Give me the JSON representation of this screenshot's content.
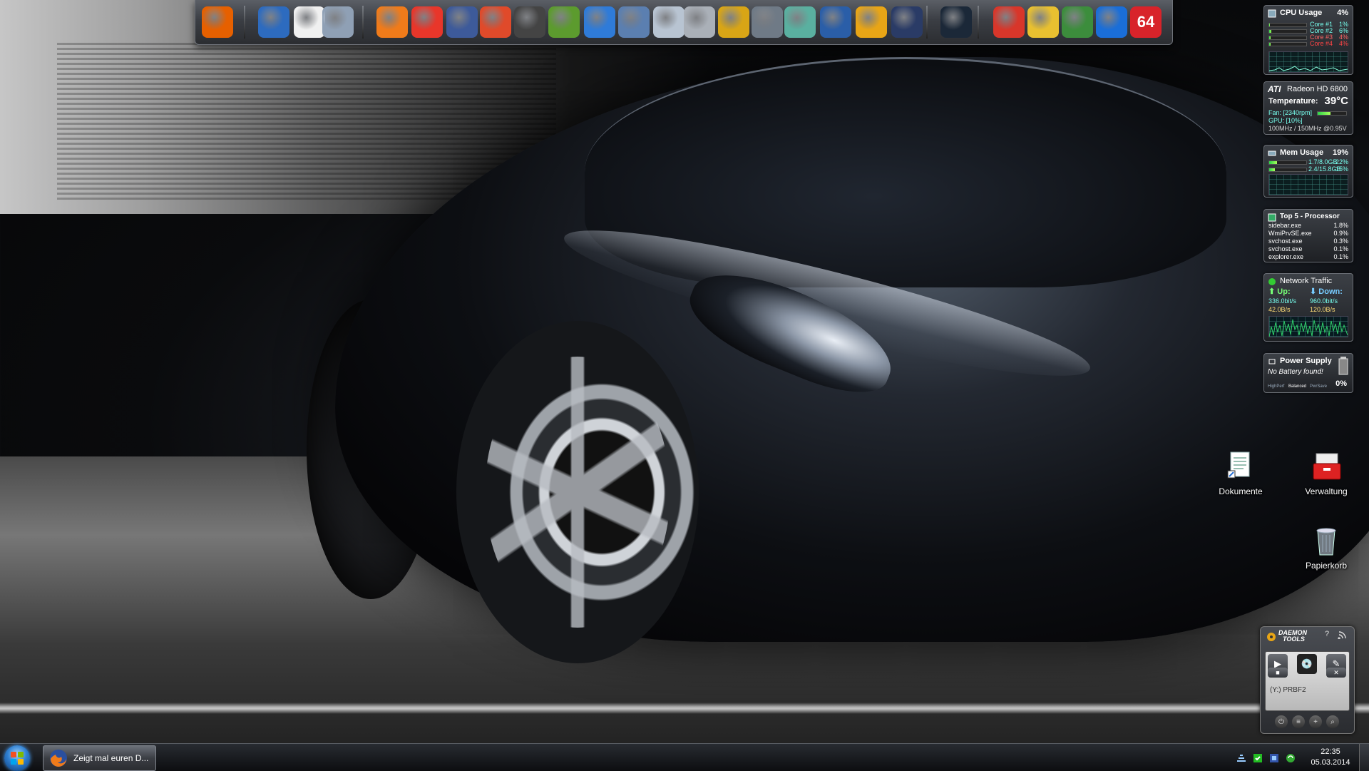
{
  "dock": {
    "icons": [
      {
        "name": "firefox-icon",
        "color": "#e66000"
      },
      {
        "name": "thunderbird-icon",
        "color": "#2d6bbf"
      },
      {
        "name": "notepad-icon",
        "color": "#f0f0f0"
      },
      {
        "name": "network-tool-icon",
        "color": "#8fa0b5"
      },
      {
        "name": "chat-icon",
        "color": "#f07b1a"
      },
      {
        "name": "flash-icon",
        "color": "#e8362a"
      },
      {
        "name": "lock-icon",
        "color": "#3d5a9a"
      },
      {
        "name": "tasks-icon",
        "color": "#e04a2a"
      },
      {
        "name": "countdown-icon",
        "color": "#444"
      },
      {
        "name": "image-editor-icon",
        "color": "#5c9b2e"
      },
      {
        "name": "cloud-icon",
        "color": "#2f7bd8"
      },
      {
        "name": "remote-desktop-icon",
        "color": "#5b7fb0"
      },
      {
        "name": "calculator-icon",
        "color": "#b8c4d2"
      },
      {
        "name": "scanner-icon",
        "color": "#aab0b8"
      },
      {
        "name": "sync-icon",
        "color": "#d8a516"
      },
      {
        "name": "audio-icon",
        "color": "#6f7a86"
      },
      {
        "name": "connection-icon",
        "color": "#5ab0a0"
      },
      {
        "name": "pulse-icon",
        "color": "#2a5ea8"
      },
      {
        "name": "power-tool-icon",
        "color": "#e8a516"
      },
      {
        "name": "video-icon",
        "color": "#2a3b66"
      },
      {
        "name": "steam-icon",
        "color": "#1b2838"
      },
      {
        "name": "ccleaner-icon",
        "color": "#d8362a"
      },
      {
        "name": "disk-tool-icon",
        "color": "#e8c030"
      },
      {
        "name": "windows-tool-icon",
        "color": "#3c8d3c"
      },
      {
        "name": "update-icon",
        "color": "#1a6ed8"
      },
      {
        "name": "aida64-icon",
        "color": "#d8232a",
        "text": "64"
      }
    ]
  },
  "gadgets": {
    "cpu": {
      "title": "CPU Usage",
      "value": "4%",
      "cores": [
        {
          "label": "Core #1",
          "value": "1%",
          "level": 0.01
        },
        {
          "label": "Core #2",
          "value": "6%",
          "level": 0.06
        },
        {
          "label": "Core #3",
          "value": "4%",
          "level": 0.04
        },
        {
          "label": "Core #4",
          "value": "4%",
          "level": 0.04
        }
      ]
    },
    "gpu": {
      "brand": "ATI",
      "title": "Radeon HD 6800",
      "temp_label": "Temperature:",
      "temp_value": "39°C",
      "fan": "Fan: [2340rpm]",
      "gpu_load": "GPU: [10%]",
      "clocks": "100MHz / 150MHz @0.95V"
    },
    "mem": {
      "title": "Mem Usage",
      "value": "19%",
      "rows": [
        {
          "text": "1.7/8.0GB",
          "pct": "22%",
          "level": 0.22
        },
        {
          "text": "2.4/15.8GB",
          "pct": "15%",
          "level": 0.15
        }
      ]
    },
    "top5": {
      "title": "Top 5 - Processor",
      "rows": [
        {
          "name": "sidebar.exe",
          "value": "1.8%"
        },
        {
          "name": "WmiPrvSE.exe",
          "value": "0.9%"
        },
        {
          "name": "svchost.exe",
          "value": "0.3%"
        },
        {
          "name": "svchost.exe",
          "value": "0.1%"
        },
        {
          "name": "explorer.exe",
          "value": "0.1%"
        }
      ]
    },
    "network": {
      "title": "Network Traffic",
      "up_label": "Up:",
      "down_label": "Down:",
      "up_rate": "336.0bit/s",
      "down_rate": "960.0bit/s",
      "up_total": "42.0B/s",
      "down_total": "120.0B/s"
    },
    "power": {
      "title": "Power Supply",
      "status": "No Battery found!",
      "plans": [
        "HighPerf",
        "Balanced",
        "PwrSave"
      ],
      "value": "0%"
    }
  },
  "desktop_icons": [
    {
      "label": "Dokumente"
    },
    {
      "label": "Verwaltung"
    },
    {
      "label": "Papierkorb"
    }
  ],
  "daemon": {
    "brand_top": "DAEMON",
    "brand_bottom": "TOOLS",
    "help": "?",
    "drive": "(Y:) PRBF2"
  },
  "taskbar": {
    "task_title": "Zeigt mal euren D...",
    "time": "22:35",
    "date": "05.03.2014"
  }
}
